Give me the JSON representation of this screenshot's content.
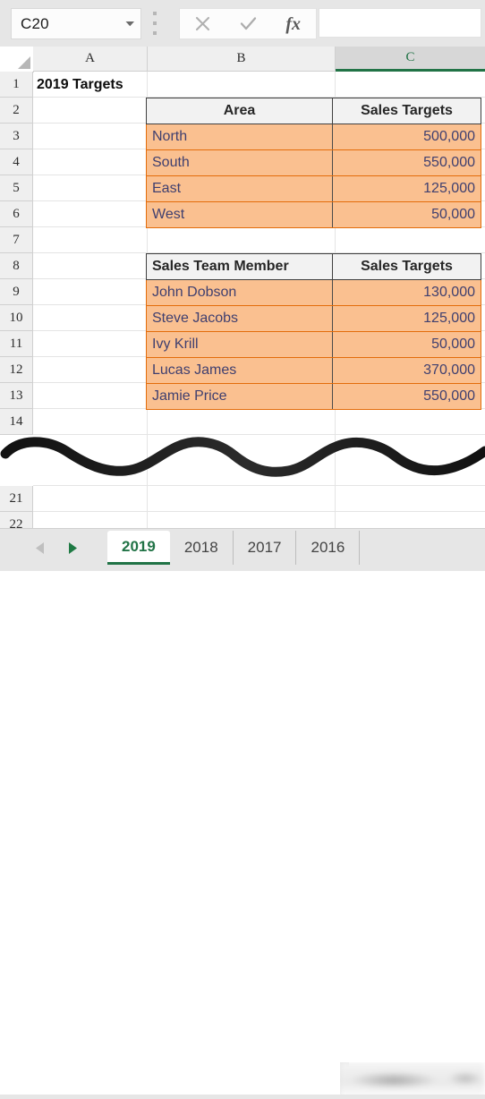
{
  "formula_bar": {
    "name_box_value": "C20",
    "name_box_dropdown_icon": "chevron-down-icon",
    "cancel_icon": "close-x-icon",
    "enter_icon": "checkmark-icon",
    "insert_function_icon": "fx-icon",
    "insert_function_label": "fx",
    "formula_value": "",
    "formula_placeholder": ""
  },
  "grid": {
    "selected_cell": "C20",
    "column_headers": [
      "A",
      "B",
      "C"
    ],
    "selected_column": "C",
    "row_headers": [
      "1",
      "2",
      "3",
      "4",
      "5",
      "6",
      "7",
      "8",
      "9",
      "10",
      "11",
      "12",
      "13",
      "14",
      "21",
      "22"
    ],
    "a1_text": "2019 Targets"
  },
  "table_area": {
    "headers": [
      "Area",
      "Sales Targets"
    ],
    "rows": [
      {
        "label": "North",
        "value": "500,000"
      },
      {
        "label": "South",
        "value": "550,000"
      },
      {
        "label": "East",
        "value": "125,000"
      },
      {
        "label": "West",
        "value": "50,000"
      }
    ]
  },
  "table_team": {
    "headers": [
      "Sales Team Member",
      "Sales Targets"
    ],
    "rows": [
      {
        "label": "John Dobson",
        "value": "130,000"
      },
      {
        "label": "Steve Jacobs",
        "value": "125,000"
      },
      {
        "label": "Ivy Krill",
        "value": "50,000"
      },
      {
        "label": "Lucas James",
        "value": "370,000"
      },
      {
        "label": "Jamie Price",
        "value": "550,000"
      }
    ]
  },
  "annotation": {
    "type": "squiggly-line",
    "description": "hand-drawn wavy line across rows 14-21"
  },
  "sheet_tabs": {
    "prev_icon": "triangle-left-icon",
    "next_icon": "triangle-right-icon",
    "tabs": [
      {
        "label": "2019",
        "active": true
      },
      {
        "label": "2018",
        "active": false
      },
      {
        "label": "2017",
        "active": false
      },
      {
        "label": "2016",
        "active": false
      }
    ],
    "blurred_region": true
  },
  "colors": {
    "accent_green": "#217346",
    "cell_fill": "#fac090",
    "cell_text": "#3f3f6f",
    "cell_border": "#e36c0a",
    "header_fill": "#f2f2f2",
    "chrome": "#e6e6e6"
  }
}
